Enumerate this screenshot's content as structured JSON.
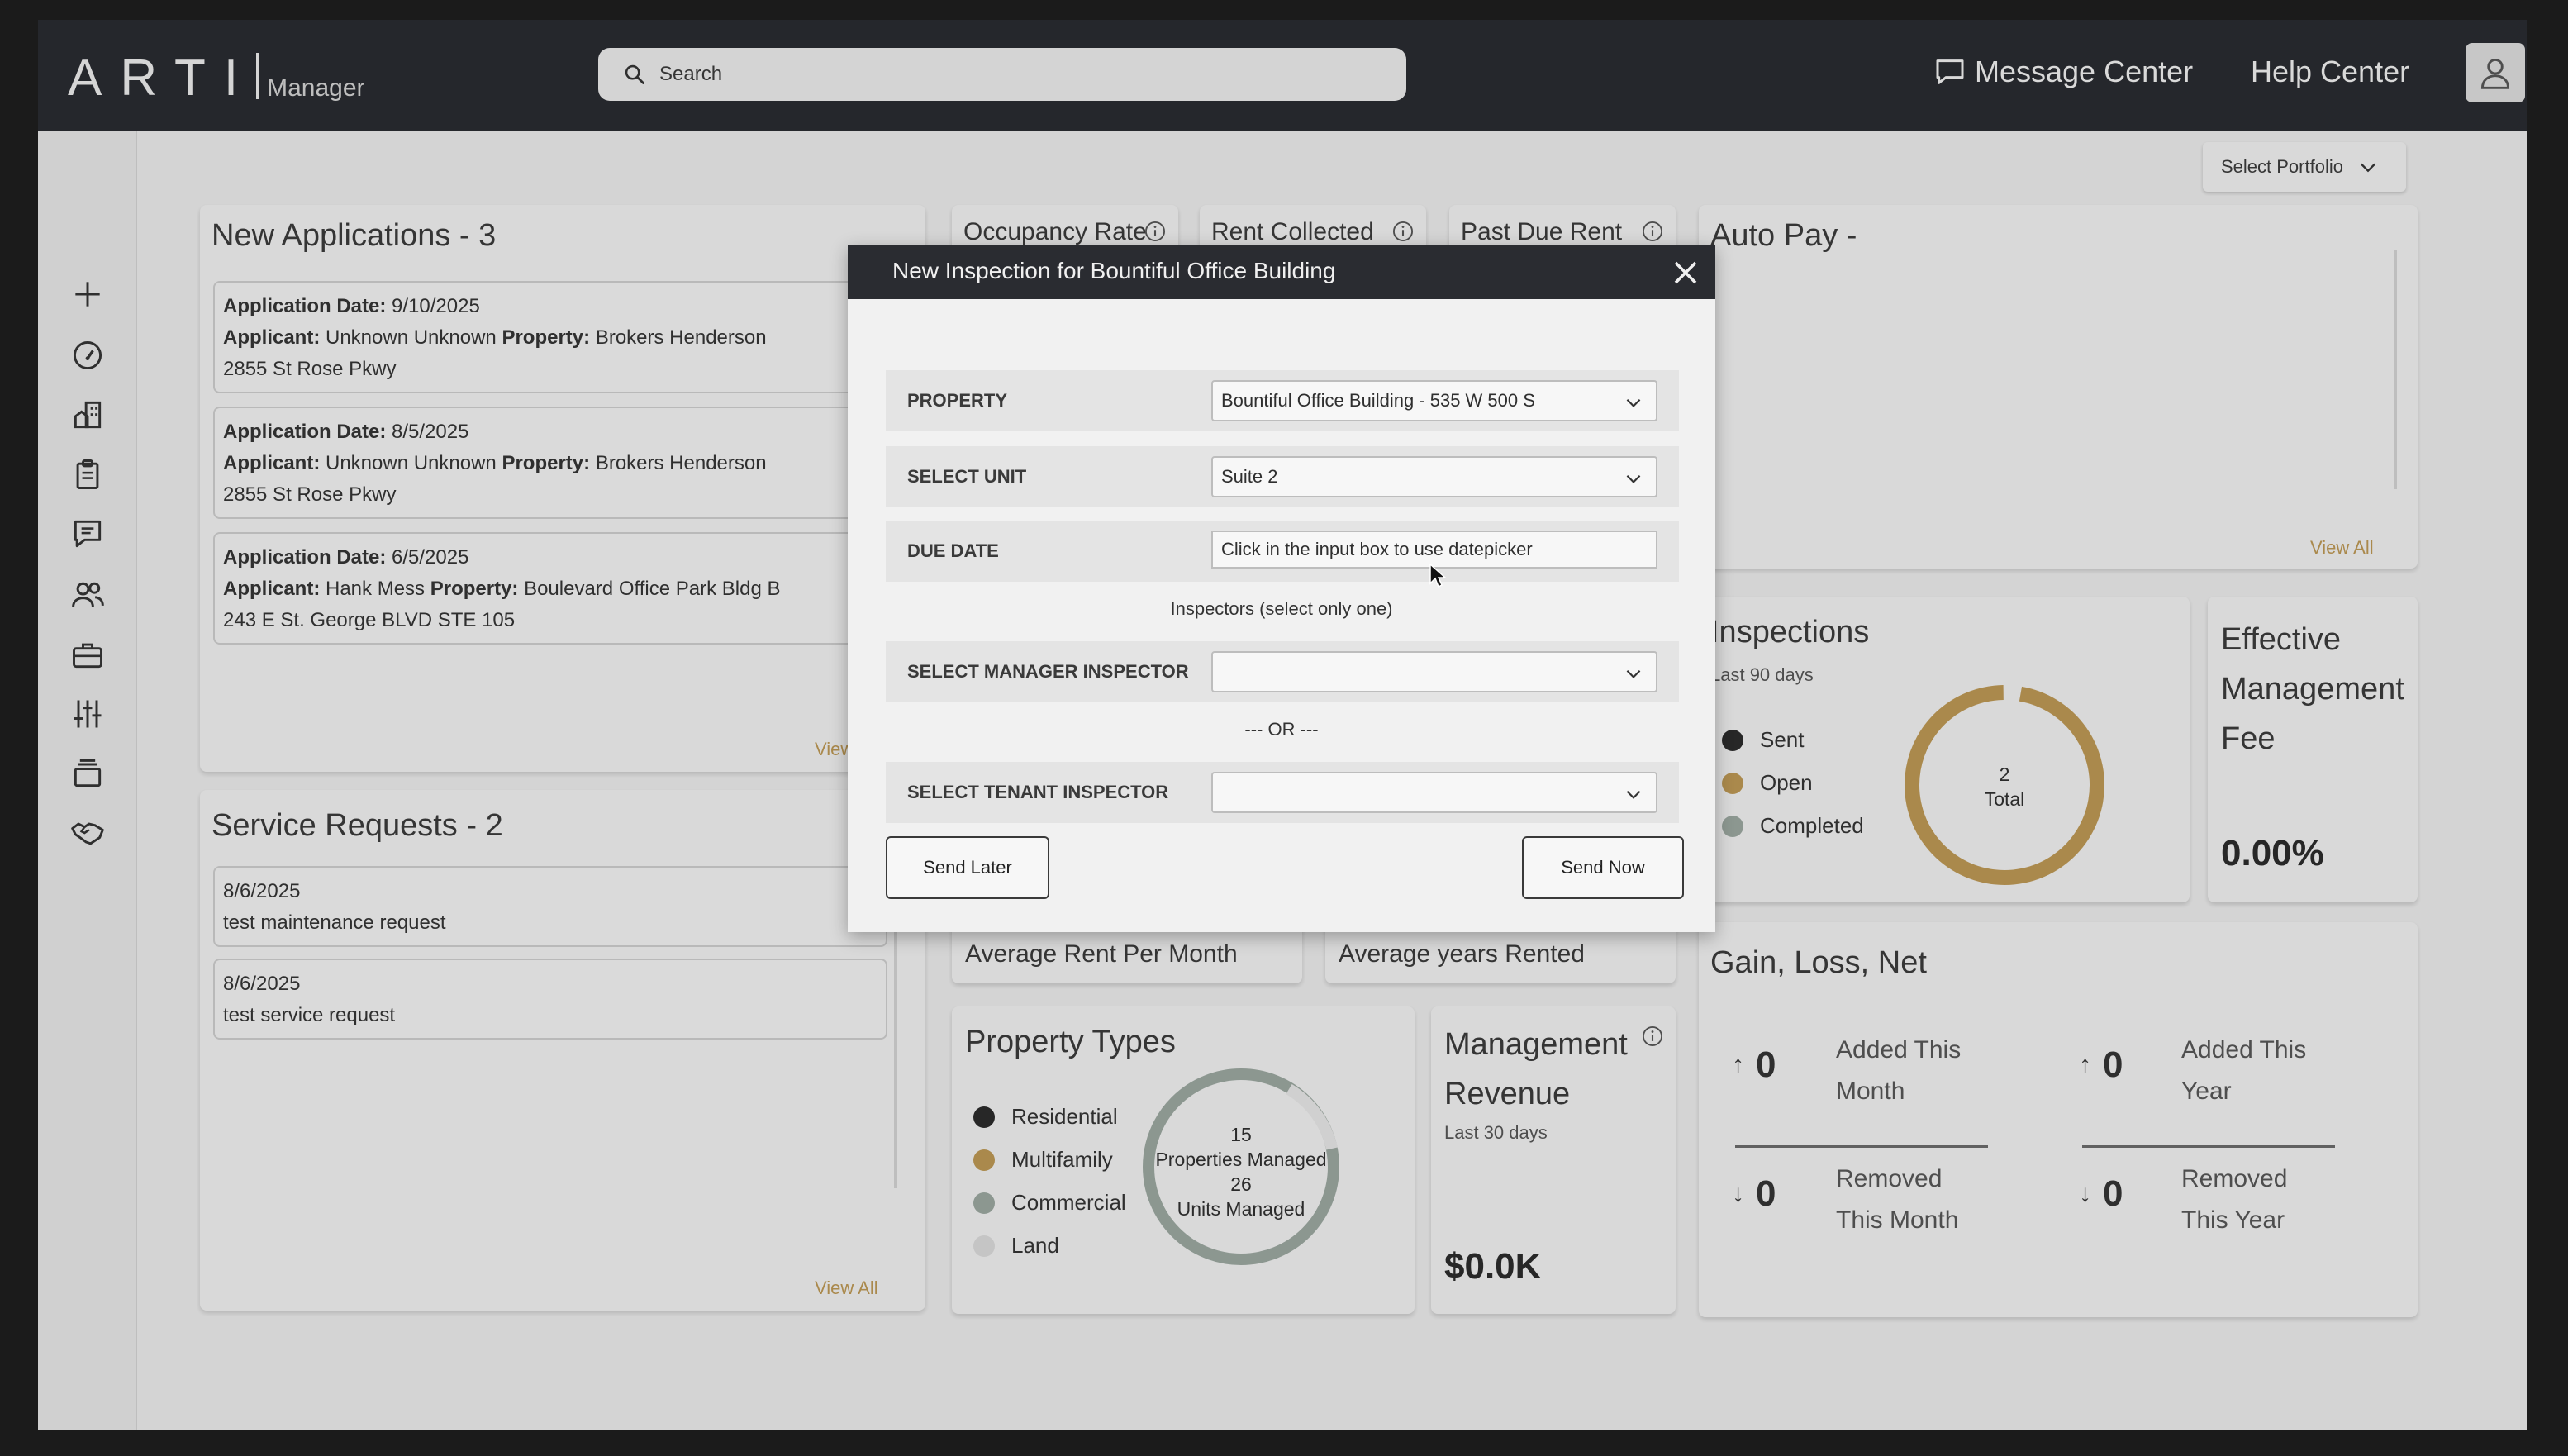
{
  "header": {
    "logo_main": "ARTI",
    "logo_sub": "Manager",
    "search_placeholder": "Search",
    "message_center": "Message Center",
    "help_center": "Help Center"
  },
  "portfolio": {
    "label": "Select Portfolio"
  },
  "applications": {
    "title": "New Applications - 3",
    "view_all": "View All",
    "items": [
      {
        "date_label": "Application Date:",
        "date": "9/10/2025",
        "applicant_label": "Applicant:",
        "applicant": "Unknown Unknown",
        "property_label": "Property:",
        "property": "Brokers Henderson",
        "address": "2855 St Rose Pkwy"
      },
      {
        "date_label": "Application Date:",
        "date": "8/5/2025",
        "applicant_label": "Applicant:",
        "applicant": "Unknown Unknown",
        "property_label": "Property:",
        "property": "Brokers Henderson",
        "address": "2855 St Rose Pkwy"
      },
      {
        "date_label": "Application Date:",
        "date": "6/5/2025",
        "applicant_label": "Applicant:",
        "applicant": "Hank Mess",
        "property_label": "Property:",
        "property": "Boulevard Office Park Bldg B",
        "address": "243 E St. George BLVD STE 105"
      }
    ]
  },
  "service_requests": {
    "title": "Service Requests - 2",
    "view_all": "View All",
    "items": [
      {
        "date": "8/6/2025",
        "text": "test maintenance request"
      },
      {
        "date": "8/6/2025",
        "text": "test service request"
      }
    ]
  },
  "metrics": {
    "occupancy_rate": "Occupancy Rate",
    "rent_collected": "Rent Collected",
    "past_due_rent": "Past Due Rent",
    "average_rent": "Average Rent Per Month",
    "average_years": "Average years Rented"
  },
  "auto_pay": {
    "title": "Auto Pay -",
    "view_all": "View All"
  },
  "inspections": {
    "title": "Inspections",
    "subtitle": "Last 90 days",
    "legend": [
      "Sent",
      "Open",
      "Completed"
    ],
    "total_value": "2",
    "total_label": "Total",
    "colors": {
      "sent": "#2b2b2b",
      "open": "#b99553",
      "completed": "#98a49d"
    },
    "values": {
      "sent": 0,
      "open": 2,
      "completed": 0
    }
  },
  "effective_fee": {
    "title_line1": "Effective",
    "title_line2": "Management",
    "title_line3": "Fee",
    "value": "0.00%"
  },
  "property_types": {
    "title": "Property Types",
    "legend": [
      "Residential",
      "Multifamily",
      "Commercial",
      "Land"
    ],
    "colors": {
      "residential": "#2b2b2b",
      "multifamily": "#b99553",
      "commercial": "#98a49d",
      "land": "#d6d6d6"
    },
    "properties_count": "15",
    "properties_label": "Properties Managed",
    "units_count": "26",
    "units_label": "Units Managed"
  },
  "management_revenue": {
    "title_line1": "Management",
    "title_line2": "Revenue",
    "subtitle": "Last 30 days",
    "value": "$0.0K"
  },
  "gain_loss": {
    "title": "Gain, Loss, Net",
    "added_month_value": "0",
    "added_month_line1": "Added This",
    "added_month_line2": "Month",
    "added_year_value": "0",
    "added_year_line1": "Added This",
    "added_year_line2": "Year",
    "removed_month_value": "0",
    "removed_month_line1": "Removed",
    "removed_month_line2": "This Month",
    "removed_year_value": "0",
    "removed_year_line1": "Removed",
    "removed_year_line2": "This Year"
  },
  "modal": {
    "title": "New Inspection for Bountiful Office Building",
    "property_label": "PROPERTY",
    "property_value": "Bountiful Office Building - 535 W 500 S",
    "unit_label": "SELECT UNIT",
    "unit_value": "Suite 2",
    "due_date_label": "DUE DATE",
    "due_date_value": "Click in the input box to use datepicker",
    "inspectors_note": "Inspectors (select only one)",
    "manager_label": "SELECT MANAGER INSPECTOR",
    "manager_value": "",
    "or_text": "--- OR ---",
    "tenant_label": "SELECT TENANT INSPECTOR",
    "tenant_value": "",
    "send_later": "Send Later",
    "send_now": "Send Now"
  }
}
